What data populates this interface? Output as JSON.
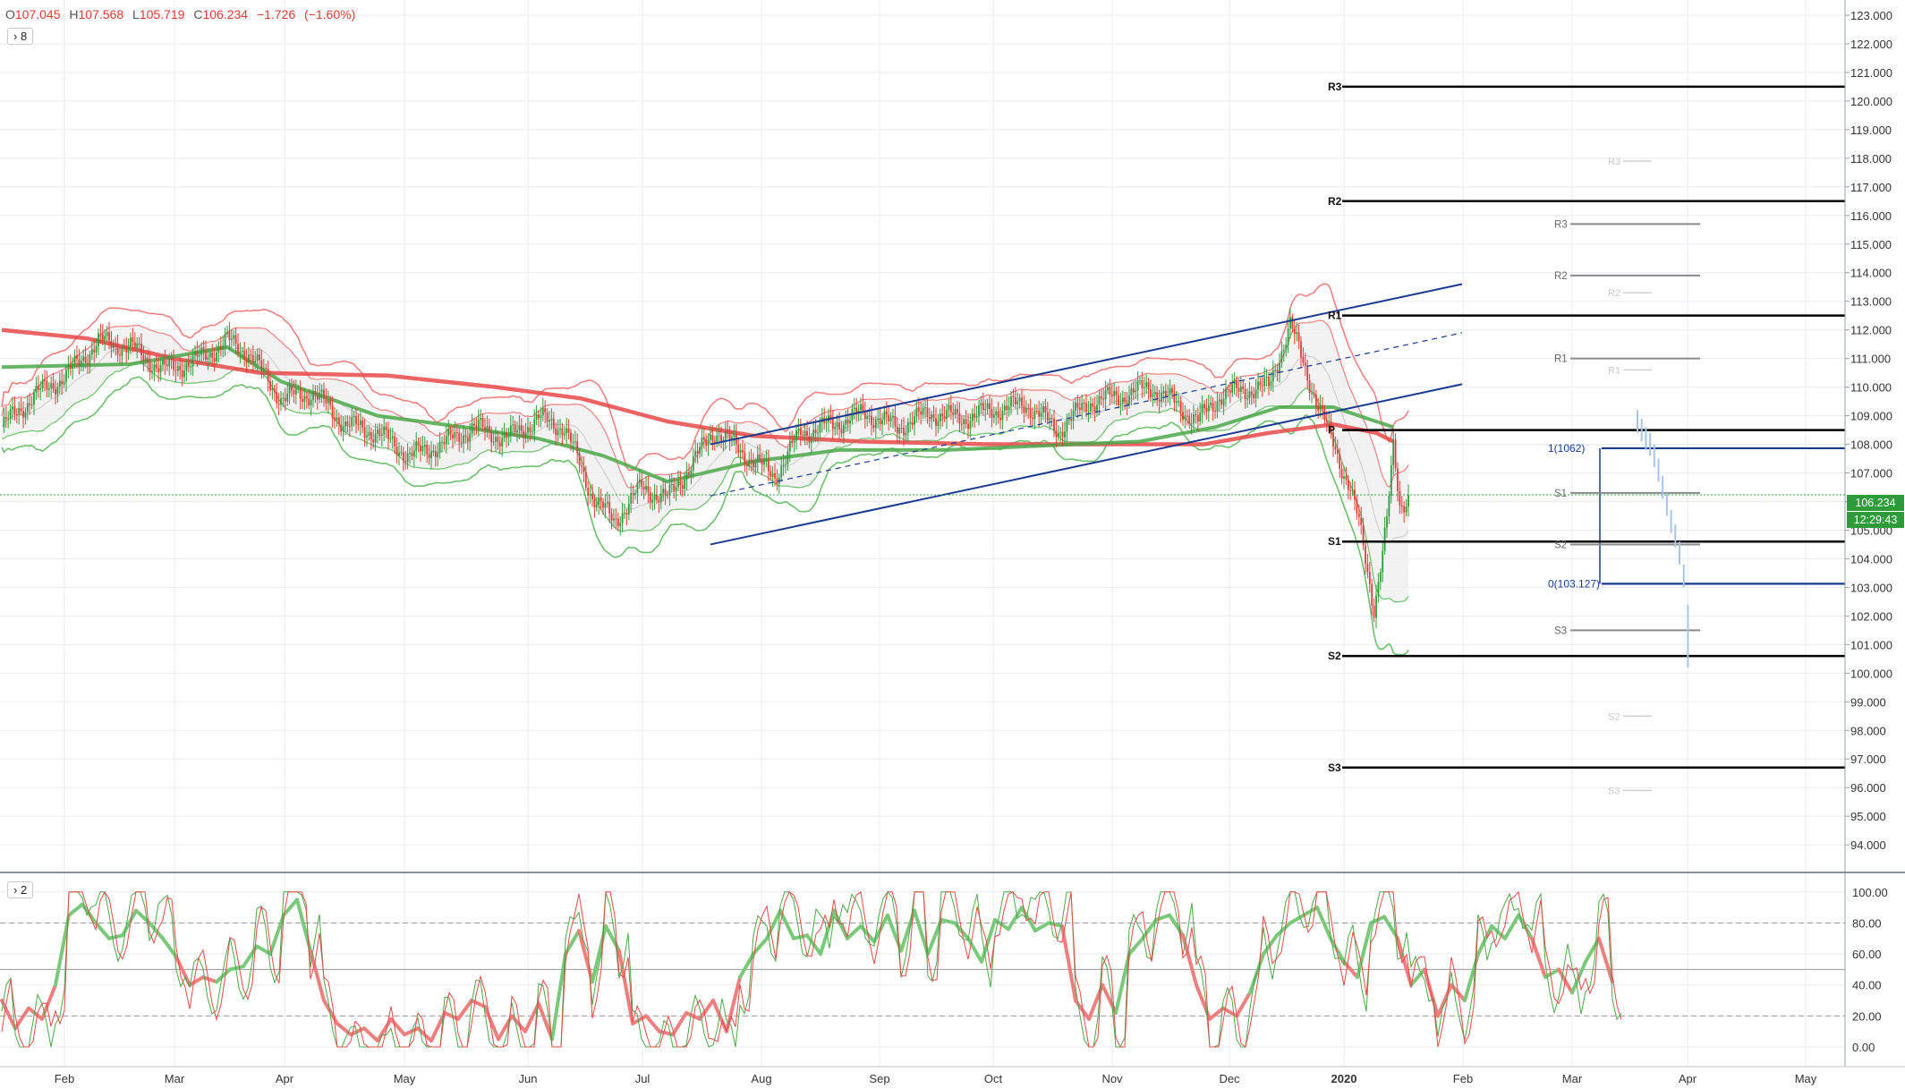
{
  "legend": {
    "open": "107.045",
    "high": "107.568",
    "low": "105.719",
    "close": "106.234",
    "change": "−1.726",
    "change_pct": "(−1.60%)"
  },
  "main_pane_badge": "8",
  "osc_pane_badge": "2",
  "last_price_tag": "106.234",
  "countdown_tag": "12:29:43",
  "colors": {
    "up": "#2e9b3a",
    "down": "#e53935",
    "trend": "#1a3a8f",
    "pivot": "#000000"
  },
  "chart_data": [
    {
      "type": "candlestick",
      "y_axis": {
        "min": 94.0,
        "max": 123.0,
        "step": 1.0,
        "position": "right",
        "tick_labels": [
          "94.000",
          "95.000",
          "96.000",
          "97.000",
          "98.000",
          "99.000",
          "100.000",
          "101.000",
          "102.000",
          "103.000",
          "104.000",
          "105.000",
          "106.000",
          "107.000",
          "108.000",
          "109.000",
          "110.000",
          "111.000",
          "112.000",
          "113.000",
          "114.000",
          "115.000",
          "116.000",
          "117.000",
          "118.000",
          "119.000",
          "120.000",
          "121.000",
          "122.000",
          "123.000"
        ]
      },
      "x_axis": {
        "tick_labels": [
          "Feb",
          "Mar",
          "Apr",
          "May",
          "Jun",
          "Jul",
          "Aug",
          "Sep",
          "Oct",
          "Nov",
          "Dec",
          "2020",
          "Feb",
          "Mar",
          "Apr",
          "May"
        ]
      },
      "price_path": [
        [
          0,
          108.6
        ],
        [
          15,
          109.7
        ],
        [
          30,
          110.4
        ],
        [
          45,
          111.6
        ],
        [
          60,
          111.4
        ],
        [
          75,
          110.6
        ],
        [
          90,
          110.9
        ],
        [
          105,
          111.6
        ],
        [
          115,
          111.2
        ],
        [
          130,
          109.6
        ],
        [
          145,
          109.8
        ],
        [
          160,
          108.7
        ],
        [
          175,
          108.4
        ],
        [
          190,
          107.6
        ],
        [
          205,
          108.0
        ],
        [
          220,
          108.6
        ],
        [
          235,
          108.2
        ],
        [
          250,
          108.9
        ],
        [
          262,
          108.6
        ],
        [
          275,
          106.2
        ],
        [
          285,
          105.3
        ],
        [
          298,
          106.5
        ],
        [
          310,
          106.1
        ],
        [
          322,
          107.4
        ],
        [
          332,
          108.5
        ],
        [
          347,
          107.6
        ],
        [
          360,
          106.9
        ],
        [
          372,
          108.4
        ],
        [
          387,
          108.7
        ],
        [
          402,
          109.1
        ],
        [
          417,
          108.6
        ],
        [
          432,
          109.1
        ],
        [
          447,
          108.9
        ],
        [
          462,
          109.2
        ],
        [
          477,
          109.4
        ],
        [
          492,
          108.5
        ],
        [
          507,
          109.5
        ],
        [
          522,
          109.7
        ],
        [
          535,
          110.0
        ],
        [
          547,
          109.4
        ],
        [
          557,
          108.8
        ],
        [
          567,
          109.7
        ],
        [
          578,
          109.9
        ],
        [
          590,
          110.0
        ],
        [
          600,
          112.2
        ],
        [
          604,
          111.3
        ],
        [
          608,
          110.4
        ],
        [
          612,
          109.6
        ],
        [
          616,
          108.8
        ],
        [
          620,
          108.0
        ],
        [
          624,
          107.2
        ],
        [
          628,
          106.5
        ],
        [
          632,
          105.2
        ],
        [
          636,
          103.5
        ],
        [
          639,
          102.3
        ],
        [
          642,
          103.8
        ],
        [
          645,
          105.3
        ],
        [
          648,
          107.8
        ],
        [
          651,
          105.8
        ],
        [
          655,
          106.234
        ]
      ],
      "moving_average_200": [
        [
          0,
          112.0
        ],
        [
          40,
          111.7
        ],
        [
          80,
          111.0
        ],
        [
          120,
          110.5
        ],
        [
          180,
          110.4
        ],
        [
          230,
          110.0
        ],
        [
          270,
          109.6
        ],
        [
          310,
          108.8
        ],
        [
          350,
          108.3
        ],
        [
          400,
          108.1
        ],
        [
          460,
          108.0
        ],
        [
          520,
          108.0
        ],
        [
          560,
          108.0
        ],
        [
          590,
          108.4
        ],
        [
          620,
          108.7
        ],
        [
          640,
          108.4
        ],
        [
          648,
          108.1
        ]
      ],
      "moving_average_50": [
        [
          0,
          110.7
        ],
        [
          60,
          110.8
        ],
        [
          105,
          111.4
        ],
        [
          130,
          110.2
        ],
        [
          175,
          109.0
        ],
        [
          215,
          108.6
        ],
        [
          250,
          108.2
        ],
        [
          280,
          107.6
        ],
        [
          310,
          106.7
        ],
        [
          350,
          107.4
        ],
        [
          390,
          107.8
        ],
        [
          440,
          107.8
        ],
        [
          500,
          108.0
        ],
        [
          530,
          108.1
        ],
        [
          565,
          108.6
        ],
        [
          595,
          109.3
        ],
        [
          620,
          109.3
        ],
        [
          648,
          108.6
        ]
      ],
      "channel_lines": [
        {
          "name": "upper",
          "from": [
            330,
            108.0
          ],
          "to": [
            680,
            113.6
          ]
        },
        {
          "name": "lower",
          "from": [
            330,
            104.5
          ],
          "to": [
            680,
            110.1
          ]
        },
        {
          "name": "mid-dashed",
          "from": [
            330,
            106.2
          ],
          "to": [
            680,
            111.9
          ]
        }
      ],
      "fib_levels": [
        {
          "label": "1(10",
          "suffix": "62)",
          "value": 107.862,
          "from": 598,
          "to": 715
        },
        {
          "label": "0(103.127)",
          "value": 103.127,
          "from": 598,
          "to": 715
        }
      ],
      "pivots_major": [
        {
          "label": "R3",
          "value": 120.5
        },
        {
          "label": "R2",
          "value": 116.5
        },
        {
          "label": "R1",
          "value": 112.5
        },
        {
          "label": "P",
          "value": 108.5
        },
        {
          "label": "S1",
          "value": 104.6
        },
        {
          "label": "S2",
          "value": 100.6
        },
        {
          "label": "S3",
          "value": 96.7
        }
      ],
      "pivots_minor": [
        {
          "label": "R3",
          "value": 115.7
        },
        {
          "label": "R2",
          "value": 113.9
        },
        {
          "label": "R1",
          "value": 111.0
        },
        {
          "label": "S1",
          "value": 106.3
        },
        {
          "label": "S2",
          "value": 104.5
        },
        {
          "label": "S3",
          "value": 101.5
        }
      ],
      "pivots_faint": [
        {
          "label": "R3",
          "value": 117.9
        },
        {
          "label": "R2",
          "value": 113.3
        },
        {
          "label": "R1",
          "value": 110.6
        },
        {
          "label": "S2",
          "value": 98.5
        },
        {
          "label": "S3",
          "value": 95.9
        }
      ],
      "current_price": 106.234
    },
    {
      "type": "line",
      "name": "",
      "y_axis": {
        "min": -3,
        "max": 105,
        "tick_labels": [
          "0.00",
          "20.00",
          "40.00",
          "60.00",
          "80.00",
          "100.00"
        ]
      },
      "levels": [
        20,
        50,
        80
      ],
      "series": [
        {
          "values": [
            30,
            12,
            25,
            18,
            40,
            85,
            92,
            80,
            70,
            72,
            88,
            80,
            70,
            58,
            40,
            45,
            42,
            50,
            52,
            65,
            60,
            85,
            95,
            62,
            30,
            15,
            8,
            12,
            4,
            18,
            8,
            12,
            4,
            22,
            18,
            30,
            26,
            5,
            20,
            10,
            28,
            5,
            60,
            75,
            42,
            78,
            62,
            15,
            20,
            10,
            8,
            22,
            18,
            30,
            10,
            45,
            60,
            70,
            88,
            70,
            72,
            60,
            88,
            70,
            78,
            68,
            85,
            62,
            88,
            60,
            82,
            80,
            70,
            55,
            82,
            76,
            90,
            75,
            80,
            78,
            30,
            18,
            40,
            22,
            60,
            70,
            82,
            85,
            72,
            40,
            18,
            25,
            20,
            35,
            60,
            72,
            80,
            85,
            90,
            70,
            55,
            45,
            80,
            84,
            70,
            40,
            50,
            20,
            40,
            30,
            60,
            78,
            70,
            85,
            70,
            45,
            50,
            35,
            55,
            70,
            42
          ]
        }
      ]
    }
  ]
}
